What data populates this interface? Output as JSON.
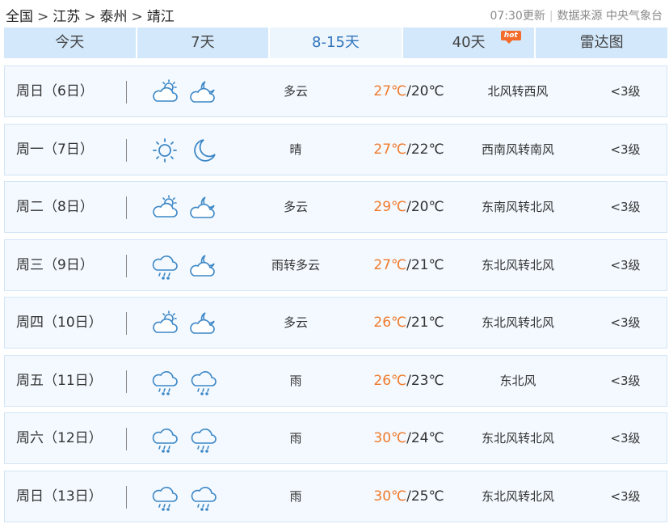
{
  "breadcrumb": {
    "items": [
      "全国",
      "江苏",
      "泰州",
      "靖江"
    ],
    "separator": ">"
  },
  "update": {
    "time": "07:30更新",
    "source": "数据来源 中央气象台"
  },
  "tabs": [
    {
      "label": "今天",
      "active": false
    },
    {
      "label": "7天",
      "active": false
    },
    {
      "label": "8-15天",
      "active": true
    },
    {
      "label": "40天",
      "active": false,
      "badge": "hot"
    },
    {
      "label": "雷达图",
      "active": false
    }
  ],
  "colors": {
    "tab_bg": "#d3e8fb",
    "tab_active_bg": "#eef6fd",
    "tab_active_text": "#2f73bb",
    "row_bg": "#f3f9ff",
    "high_temp": "#f07a2b",
    "icon_blue": "#3d87c6",
    "hot_badge": "#f36c2c"
  },
  "forecast": [
    {
      "day": "周日（6日）",
      "icon_day": "partly-cloudy-day-icon",
      "icon_night": "partly-cloudy-night-icon",
      "weather": "多云",
      "high": "27℃",
      "low": "/20℃",
      "wind": "北风转西风",
      "level": "<3级"
    },
    {
      "day": "周一（7日）",
      "icon_day": "sunny-icon",
      "icon_night": "moon-icon",
      "weather": "晴",
      "high": "27℃",
      "low": "/22℃",
      "wind": "西南风转南风",
      "level": "<3级"
    },
    {
      "day": "周二（8日）",
      "icon_day": "partly-cloudy-day-icon",
      "icon_night": "partly-cloudy-night-icon",
      "weather": "多云",
      "high": "29℃",
      "low": "/20℃",
      "wind": "东南风转北风",
      "level": "<3级"
    },
    {
      "day": "周三（9日）",
      "icon_day": "rain-icon",
      "icon_night": "partly-cloudy-night-icon",
      "weather": "雨转多云",
      "high": "27℃",
      "low": "/21℃",
      "wind": "东北风转北风",
      "level": "<3级"
    },
    {
      "day": "周四（10日）",
      "icon_day": "partly-cloudy-day-icon",
      "icon_night": "partly-cloudy-night-icon",
      "weather": "多云",
      "high": "26℃",
      "low": "/21℃",
      "wind": "东北风转北风",
      "level": "<3级"
    },
    {
      "day": "周五（11日）",
      "icon_day": "rain-icon",
      "icon_night": "rain-icon",
      "weather": "雨",
      "high": "26℃",
      "low": "/23℃",
      "wind": "东北风",
      "level": "<3级"
    },
    {
      "day": "周六（12日）",
      "icon_day": "rain-icon",
      "icon_night": "rain-icon",
      "weather": "雨",
      "high": "30℃",
      "low": "/24℃",
      "wind": "东北风转北风",
      "level": "<3级"
    },
    {
      "day": "周日（13日）",
      "icon_day": "rain-icon",
      "icon_night": "rain-icon",
      "weather": "雨",
      "high": "30℃",
      "low": "/25℃",
      "wind": "东北风转北风",
      "level": "<3级"
    }
  ]
}
